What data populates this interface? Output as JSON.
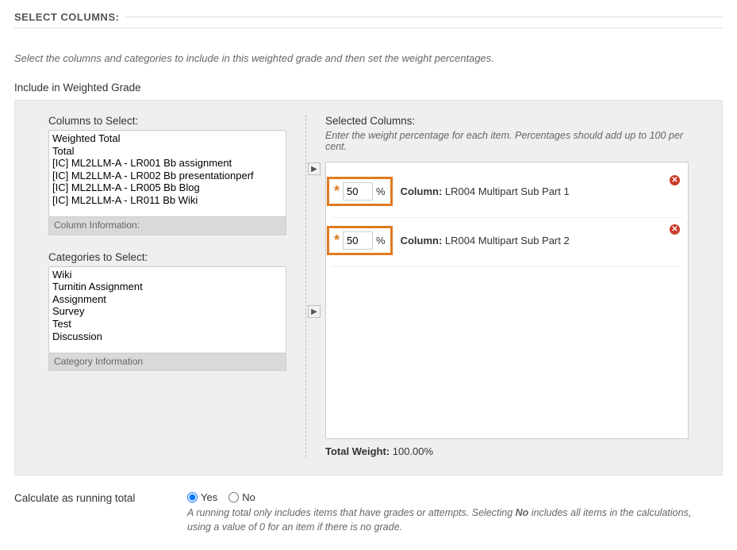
{
  "section_title": "SELECT COLUMNS:",
  "instruction": "Select the columns and categories to include in this weighted grade and then set the weight percentages.",
  "group_label": "Include in Weighted Grade",
  "columns_label": "Columns to Select:",
  "columns_options": [
    "Weighted Total",
    "Total",
    "[IC] ML2LLM-A - LR001 Bb assignment",
    "[IC] ML2LLM-A - LR002 Bb presentationperf",
    "[IC] ML2LLM-A - LR005 Bb Blog",
    "[IC] ML2LLM-A - LR011 Bb Wiki"
  ],
  "columns_info": "Column Information:",
  "categories_label": "Categories to Select:",
  "categories_options": [
    "Wiki",
    "Turnitin Assignment",
    "Assignment",
    "Survey",
    "Test",
    "Discussion"
  ],
  "categories_info": "Category Information",
  "selected_label": "Selected Columns:",
  "selected_hint": "Enter the weight percentage for each item. Percentages should add up to 100 per cent.",
  "selected_items": [
    {
      "weight": "50",
      "name": "LR004 Multipart Sub Part 1"
    },
    {
      "weight": "50",
      "name": "LR004 Multipart Sub Part 2"
    }
  ],
  "column_prefix": "Column:",
  "percent_sign": "%",
  "total_weight_label": "Total Weight:",
  "total_weight_value": "100.00%",
  "running": {
    "label": "Calculate as running total",
    "yes": "Yes",
    "no": "No",
    "selected": "yes",
    "hint_pre": "A running total only includes items that have grades or attempts. Selecting ",
    "hint_bold": "No",
    "hint_post": " includes all items in the calculations, using a value of 0 for an item if there is no grade."
  }
}
